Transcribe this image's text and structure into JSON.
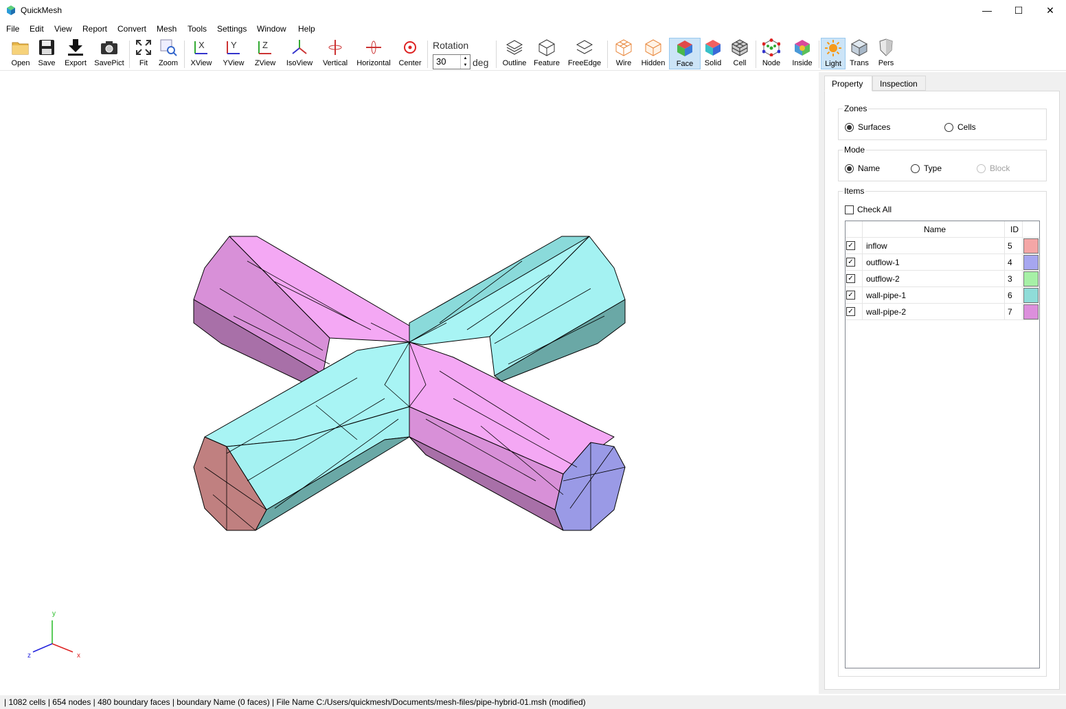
{
  "window": {
    "title": "QuickMesh",
    "min_glyph": "—",
    "max_glyph": "☐",
    "close_glyph": "✕"
  },
  "menu": [
    "File",
    "Edit",
    "View",
    "Report",
    "Convert",
    "Mesh",
    "Tools",
    "Settings",
    "Window",
    "Help"
  ],
  "toolbar": {
    "open": "Open",
    "save": "Save",
    "export": "Export",
    "savepict": "SavePict",
    "fit": "Fit",
    "zoom": "Zoom",
    "xview": "XView",
    "yview": "YView",
    "zview": "ZView",
    "isoview": "IsoView",
    "vertical": "Vertical",
    "horizontal": "Horizontal",
    "center": "Center",
    "rotation_label": "Rotation",
    "rotation_value": "30",
    "rotation_unit": "deg",
    "outline": "Outline",
    "feature": "Feature",
    "freeedge": "FreeEdge",
    "wire": "Wire",
    "hidden": "Hidden",
    "face": "Face",
    "solid": "Solid",
    "cell": "Cell",
    "node": "Node",
    "inside": "Inside",
    "light": "Light",
    "trans": "Trans",
    "pers": "Pers"
  },
  "axes": {
    "y": "y",
    "z": "z",
    "x": "x"
  },
  "panel": {
    "tabs": [
      "Property",
      "Inspection"
    ],
    "zones": {
      "title": "Zones",
      "surfaces": "Surfaces",
      "cells": "Cells"
    },
    "mode": {
      "title": "Mode",
      "name": "Name",
      "type": "Type",
      "block": "Block"
    },
    "items": {
      "title": "Items",
      "check_all": "Check All",
      "col_name": "Name",
      "col_id": "ID",
      "rows": [
        {
          "name": "inflow",
          "id": "5",
          "color": "#f4a6a6"
        },
        {
          "name": "outflow-1",
          "id": "4",
          "color": "#a6a6f0"
        },
        {
          "name": "outflow-2",
          "id": "3",
          "color": "#a6f0a6"
        },
        {
          "name": "wall-pipe-1",
          "id": "6",
          "color": "#8fdcd8"
        },
        {
          "name": "wall-pipe-2",
          "id": "7",
          "color": "#dc8fdc"
        }
      ]
    }
  },
  "status": "| 1082 cells | 654 nodes | 480 boundary faces |  boundary Name  (0 faces) | File Name C:/Users/quickmesh/Documents/mesh-files/pipe-hybrid-01.msh (modified)",
  "colors": {
    "accent": "#cce4f7",
    "cyan": "#a8f4f4",
    "magenta": "#f4a8f4",
    "inflow": "#c08080",
    "outflow": "#9a9ae6"
  }
}
